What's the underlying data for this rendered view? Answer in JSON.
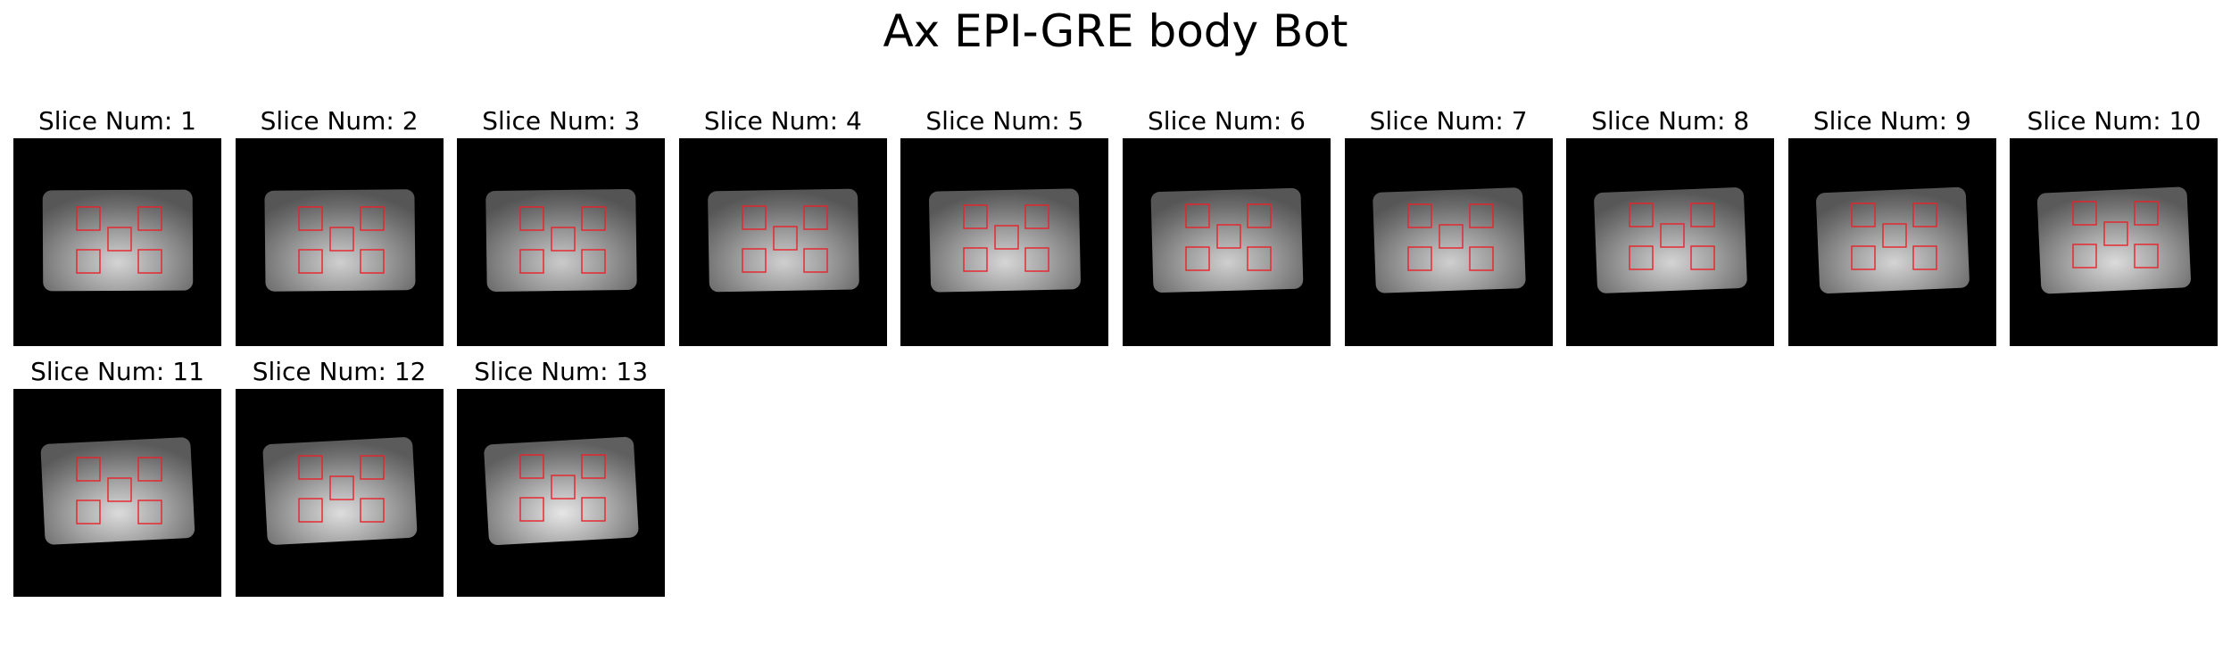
{
  "figure": {
    "title": "Ax EPI-GRE body Bot"
  },
  "colors": {
    "background": "#ffffff",
    "image_background": "#000000",
    "roi_outline": "#e8222a"
  },
  "slices": [
    {
      "label": "Slice Num: 1",
      "tilt": -0.3,
      "brightness": 0.92,
      "roi_shift": 0
    },
    {
      "label": "Slice Num: 2",
      "tilt": -0.6,
      "brightness": 0.9,
      "roi_shift": 0
    },
    {
      "label": "Slice Num: 3",
      "tilt": -0.8,
      "brightness": 0.88,
      "roi_shift": 0
    },
    {
      "label": "Slice Num: 4",
      "tilt": -1.0,
      "brightness": 0.9,
      "roi_shift": -1
    },
    {
      "label": "Slice Num: 5",
      "tilt": -1.2,
      "brightness": 0.93,
      "roi_shift": -2
    },
    {
      "label": "Slice Num: 6",
      "tilt": -1.6,
      "brightness": 0.9,
      "roi_shift": -3
    },
    {
      "label": "Slice Num: 7",
      "tilt": -2.0,
      "brightness": 0.9,
      "roi_shift": -3
    },
    {
      "label": "Slice Num: 8",
      "tilt": -2.2,
      "brightness": 0.92,
      "roi_shift": -4
    },
    {
      "label": "Slice Num: 9",
      "tilt": -2.4,
      "brightness": 0.92,
      "roi_shift": -4
    },
    {
      "label": "Slice Num: 10",
      "tilt": -2.6,
      "brightness": 0.95,
      "roi_shift": -6
    },
    {
      "label": "Slice Num: 11",
      "tilt": -2.8,
      "brightness": 0.95,
      "roi_shift": 0
    },
    {
      "label": "Slice Num: 12",
      "tilt": -3.0,
      "brightness": 0.96,
      "roi_shift": -2
    },
    {
      "label": "Slice Num: 13",
      "tilt": -3.2,
      "brightness": 1.0,
      "roi_shift": -3
    }
  ]
}
